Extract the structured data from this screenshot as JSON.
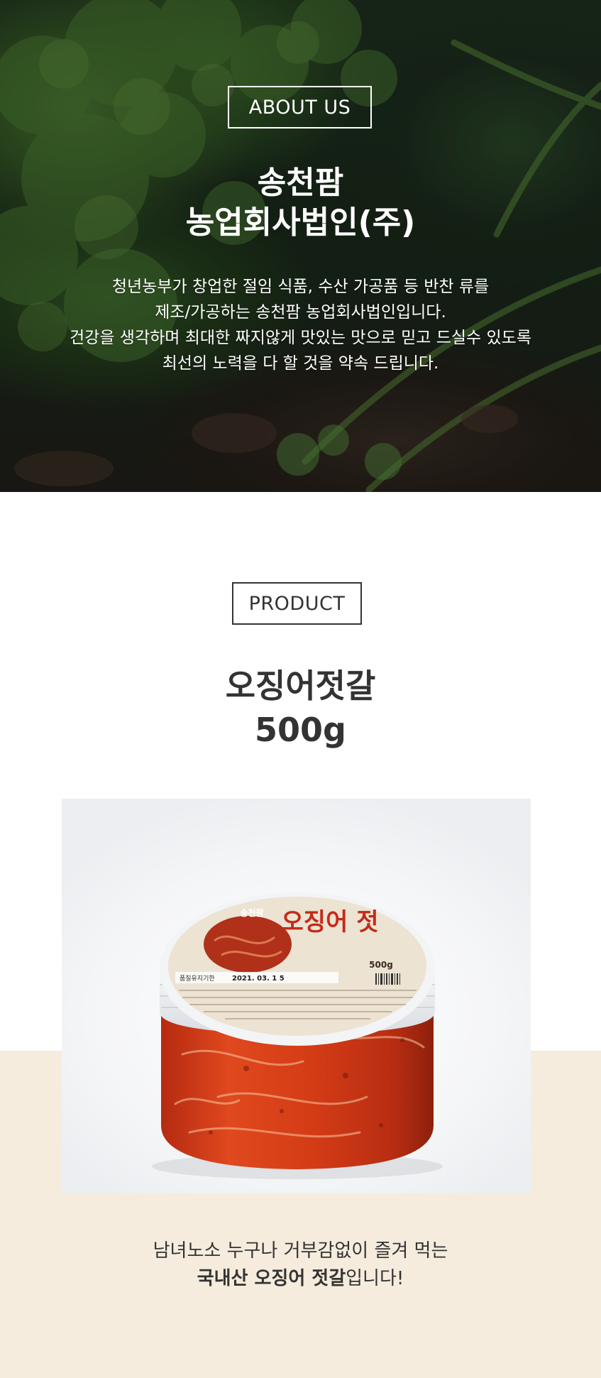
{
  "about": {
    "label": "ABOUT US",
    "title_lines": [
      "송천팜",
      "농업회사법인(주)"
    ],
    "description_lines": [
      "청년농부가 창업한 절임 식품, 수산 가공품 등 반찬 류를",
      "제조/가공하는 송천팜 농업회사법인입니다.",
      "건강을 생각하며 최대한 짜지않게 맛있는 맛으로 믿고 드실수 있도록",
      "최선의 노력을 다 할 것을 약속 드립니다."
    ]
  },
  "product": {
    "label": "PRODUCT",
    "title_lines": [
      "오징어젓갈",
      "500g"
    ],
    "jar_label": {
      "brand": "송천팜",
      "name": "오징어 젓",
      "weight": "500g",
      "expiry_label": "품질유지기한",
      "expiry_date": "2021. 03. 1 5"
    },
    "description_line1": "남녀노소 누구나 거부감없이 즐겨 먹는",
    "description_line2_bold": "국내산 오징어 젓갈",
    "description_line2_rest": "입니다!"
  },
  "colors": {
    "cream_band": "#f5ecdd",
    "text_dark": "#333333",
    "hero_text": "#ffffff"
  }
}
